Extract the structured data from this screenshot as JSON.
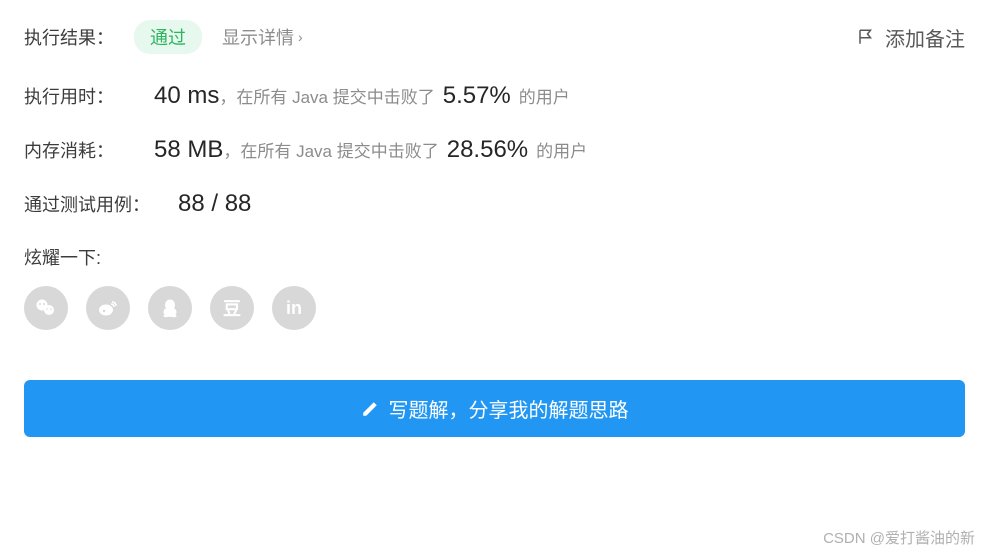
{
  "header": {
    "result_label": "执行结果：",
    "status": "通过",
    "show_details": "显示详情",
    "add_note": "添加备注"
  },
  "runtime": {
    "label": "执行用时：",
    "value": "40 ms",
    "prefix": "，在所有 Java 提交中击败了",
    "percent": "5.57%",
    "suffix": "的用户"
  },
  "memory": {
    "label": "内存消耗：",
    "value": "58 MB",
    "prefix": "，在所有 Java 提交中击败了",
    "percent": "28.56%",
    "suffix": "的用户"
  },
  "testcases": {
    "label": "通过测试用例：",
    "value": "88 / 88"
  },
  "share": {
    "label": "炫耀一下:",
    "douban": "豆",
    "linkedin": "in"
  },
  "cta": {
    "label": "写题解，分享我的解题思路"
  },
  "watermark": "CSDN @爱打酱油的新"
}
